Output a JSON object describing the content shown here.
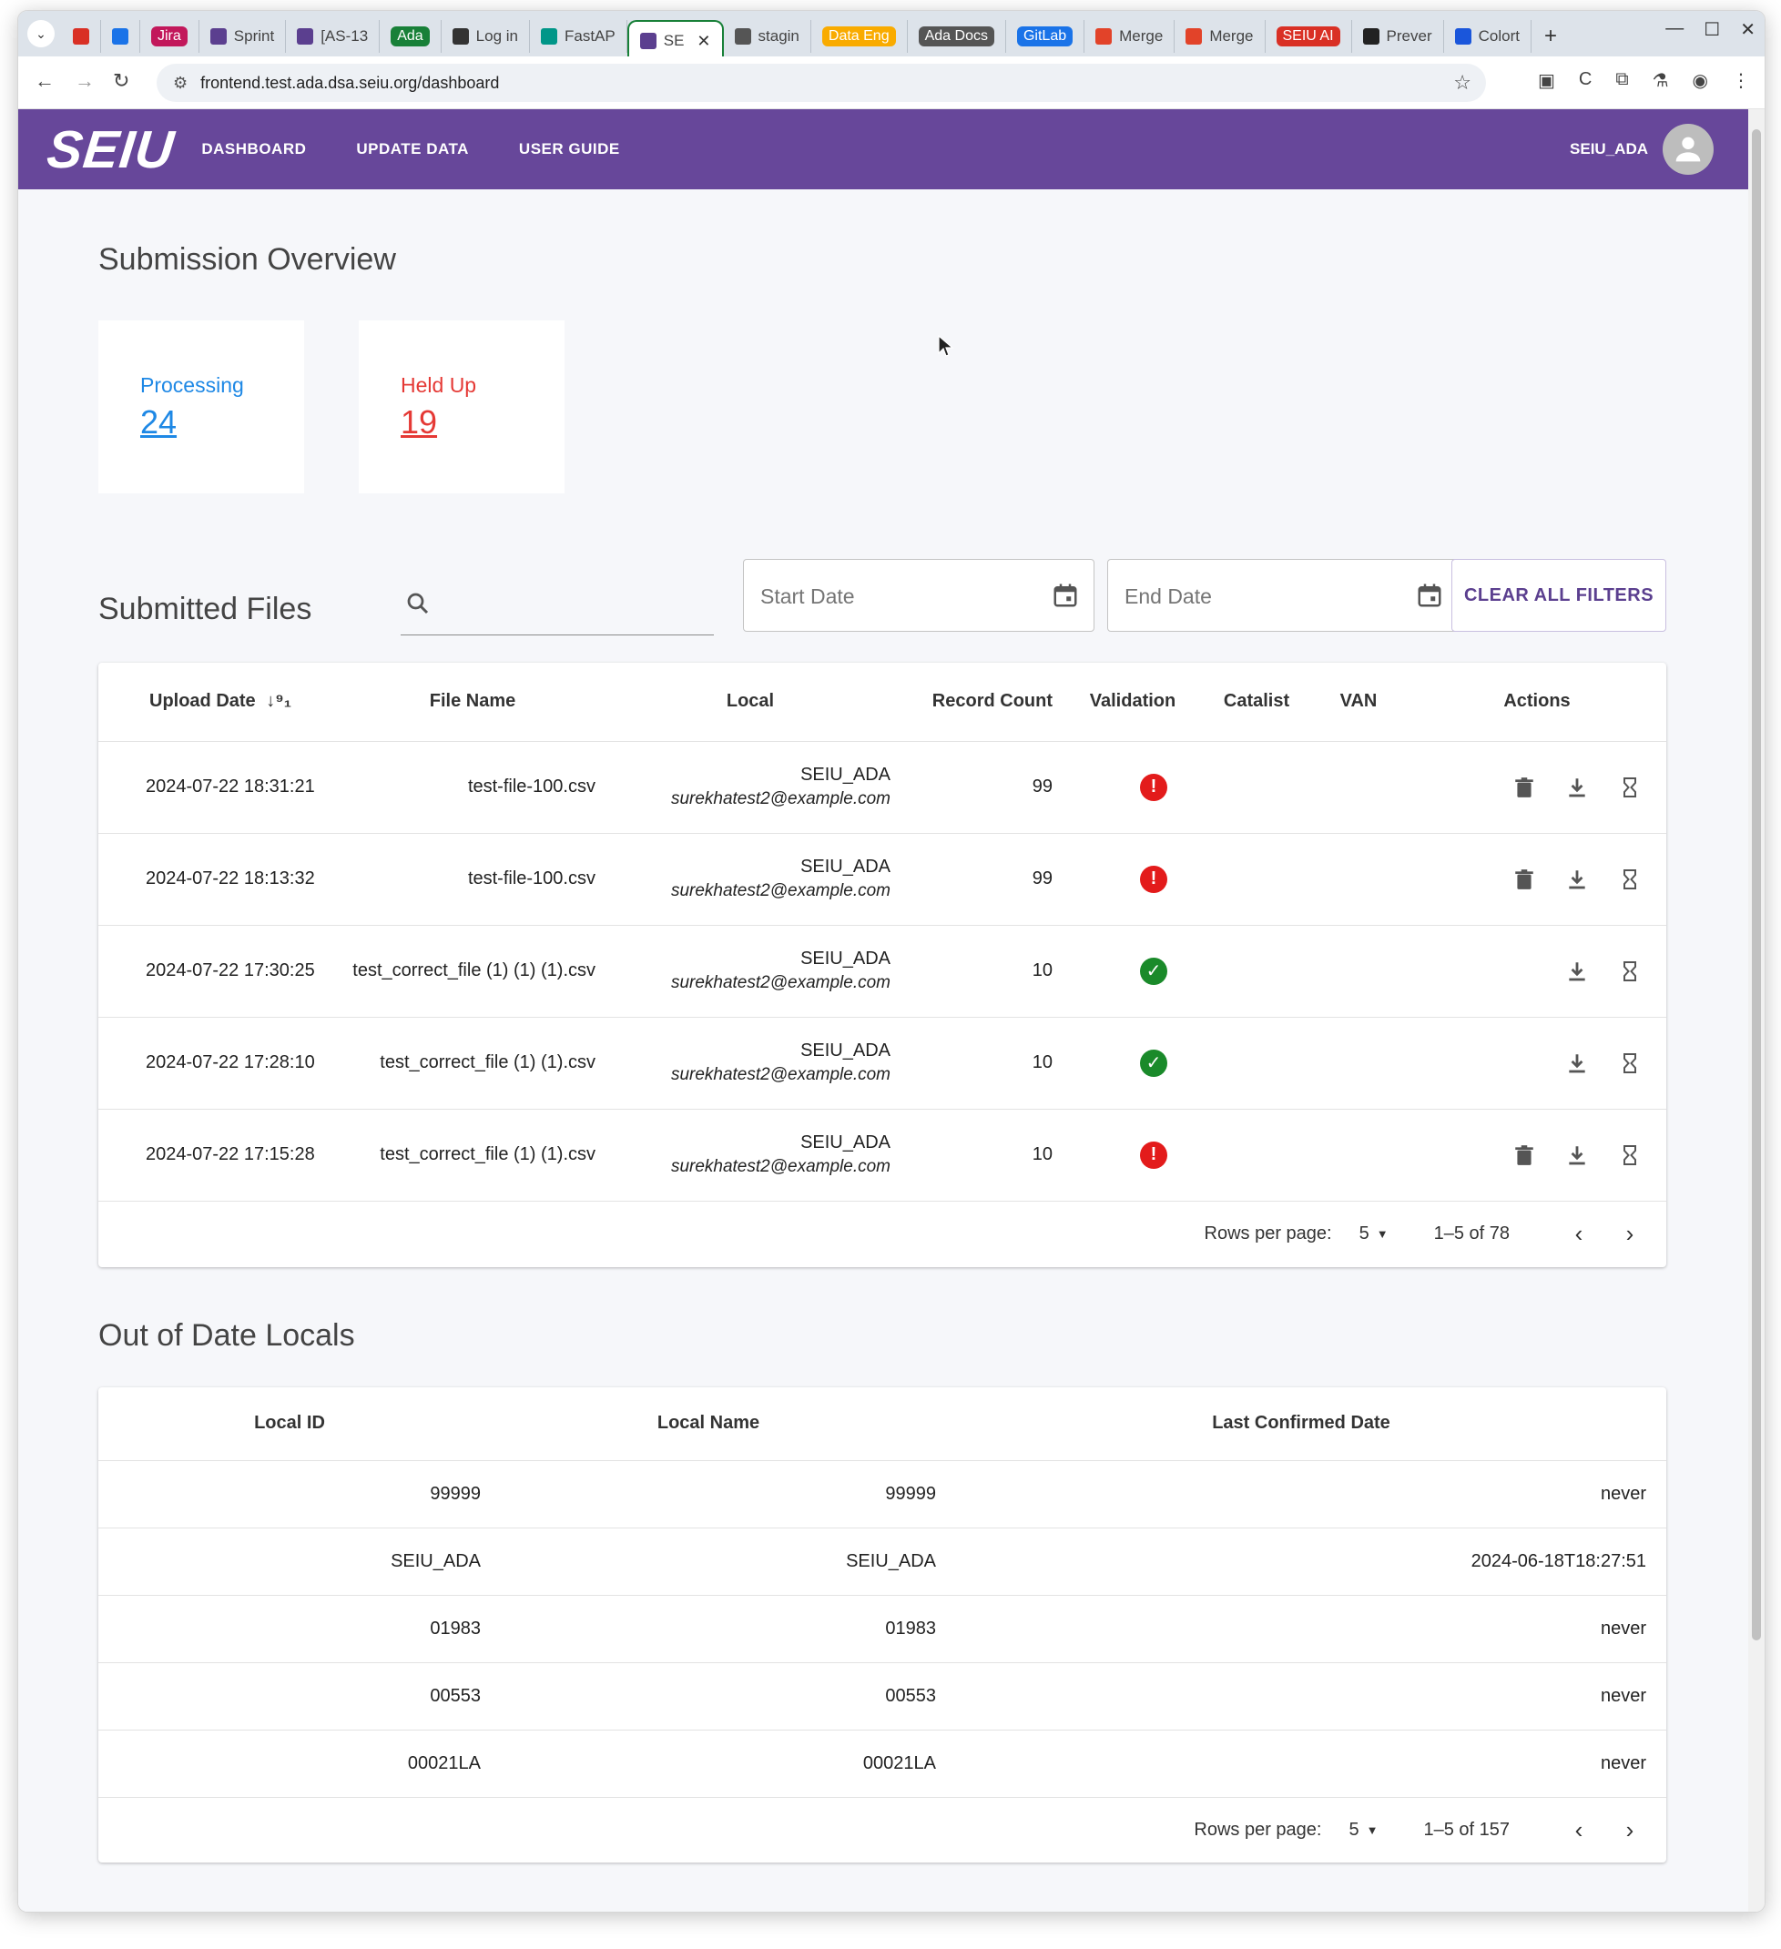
{
  "browser": {
    "tabs": [
      {
        "label": "",
        "icon": "gmail-icon",
        "color": "#d93025"
      },
      {
        "label": "",
        "icon": "calendar-icon",
        "color": "#1a73e8"
      },
      {
        "label": "Jira",
        "icon": "jira-pill",
        "color": "#c2185b"
      },
      {
        "label": "Sprint",
        "icon": "seiu-s-icon",
        "color": "#5b3f8f"
      },
      {
        "label": "[AS-13",
        "icon": "seiu-s-icon",
        "color": "#5b3f8f"
      },
      {
        "label": "Ada",
        "icon": "ada-pill",
        "color": "#188038"
      },
      {
        "label": "Log in",
        "icon": "openai-icon",
        "color": "#333333"
      },
      {
        "label": "FastAP",
        "icon": "fastapi-icon",
        "color": "#009688"
      },
      {
        "label": "SE",
        "icon": "seiu-s-icon",
        "color": "#5b3f8f",
        "active": true
      },
      {
        "label": "stagin",
        "icon": "globe-icon",
        "color": "#555555"
      },
      {
        "label": "Data Eng",
        "icon": "dataeng-pill",
        "color": "#f9ab00"
      },
      {
        "label": "Ada Docs",
        "icon": "adadocs-pill",
        "color": "#555555"
      },
      {
        "label": "GitLab",
        "icon": "gitlab-pill",
        "color": "#1a73e8"
      },
      {
        "label": "Merge",
        "icon": "gitlab-icon",
        "color": "#e24329"
      },
      {
        "label": "Merge",
        "icon": "gitlab-icon",
        "color": "#e24329"
      },
      {
        "label": "SEIU AI",
        "icon": "seiuai-pill",
        "color": "#d93025"
      },
      {
        "label": "Prever",
        "icon": "preview-icon",
        "color": "#222222"
      },
      {
        "label": "Colort",
        "icon": "colort-icon",
        "color": "#1a56db"
      }
    ],
    "url": "frontend.test.ada.dsa.seiu.org/dashboard"
  },
  "app": {
    "logo": "SEIU",
    "nav": [
      "DASHBOARD",
      "UPDATE DATA",
      "USER GUIDE"
    ],
    "user": "SEIU_ADA",
    "accent": "#67479a"
  },
  "overview": {
    "title": "Submission Overview",
    "processing": {
      "label": "Processing",
      "value": "24",
      "color": "#1e88e5"
    },
    "held_up": {
      "label": "Held Up",
      "value": "19",
      "color": "#e53935"
    }
  },
  "files": {
    "title": "Submitted Files",
    "search_placeholder": "",
    "start_date_placeholder": "Start Date",
    "end_date_placeholder": "End Date",
    "clear_label": "CLEAR ALL FILTERS",
    "columns": [
      "Upload Date",
      "File Name",
      "Local",
      "Record Count",
      "Validation",
      "Catalist",
      "VAN",
      "Actions"
    ],
    "rows": [
      {
        "date": "2024-07-22 18:31:21",
        "file": "test-file-100.csv",
        "local": "SEIU_ADA",
        "email": "surekhatest2@example.com",
        "count": "99",
        "validation": "error",
        "catalist": "",
        "van": "",
        "deletable": true
      },
      {
        "date": "2024-07-22 18:13:32",
        "file": "test-file-100.csv",
        "local": "SEIU_ADA",
        "email": "surekhatest2@example.com",
        "count": "99",
        "validation": "error",
        "catalist": "",
        "van": "",
        "deletable": true
      },
      {
        "date": "2024-07-22 17:30:25",
        "file": "test_correct_file (1) (1) (1).csv",
        "local": "SEIU_ADA",
        "email": "surekhatest2@example.com",
        "count": "10",
        "validation": "ok",
        "catalist": "",
        "van": "",
        "deletable": false
      },
      {
        "date": "2024-07-22 17:28:10",
        "file": "test_correct_file (1) (1).csv",
        "local": "SEIU_ADA",
        "email": "surekhatest2@example.com",
        "count": "10",
        "validation": "ok",
        "catalist": "",
        "van": "",
        "deletable": false
      },
      {
        "date": "2024-07-22 17:15:28",
        "file": "test_correct_file (1) (1).csv",
        "local": "SEIU_ADA",
        "email": "surekhatest2@example.com",
        "count": "10",
        "validation": "error",
        "catalist": "",
        "van": "",
        "deletable": true
      }
    ],
    "pager": {
      "rows_label": "Rows per page:",
      "rows_value": "5",
      "range": "1–5 of 78"
    }
  },
  "locals": {
    "title": "Out of Date Locals",
    "columns": [
      "Local ID",
      "Local Name",
      "Last Confirmed Date"
    ],
    "rows": [
      {
        "id": "99999",
        "name": "99999",
        "date": "never"
      },
      {
        "id": "SEIU_ADA",
        "name": "SEIU_ADA",
        "date": "2024-06-18T18:27:51"
      },
      {
        "id": "01983",
        "name": "01983",
        "date": "never"
      },
      {
        "id": "00553",
        "name": "00553",
        "date": "never"
      },
      {
        "id": "00021LA",
        "name": "00021LA",
        "date": "never"
      }
    ],
    "pager": {
      "rows_label": "Rows per page:",
      "rows_value": "5",
      "range": "1–5 of 157"
    }
  }
}
